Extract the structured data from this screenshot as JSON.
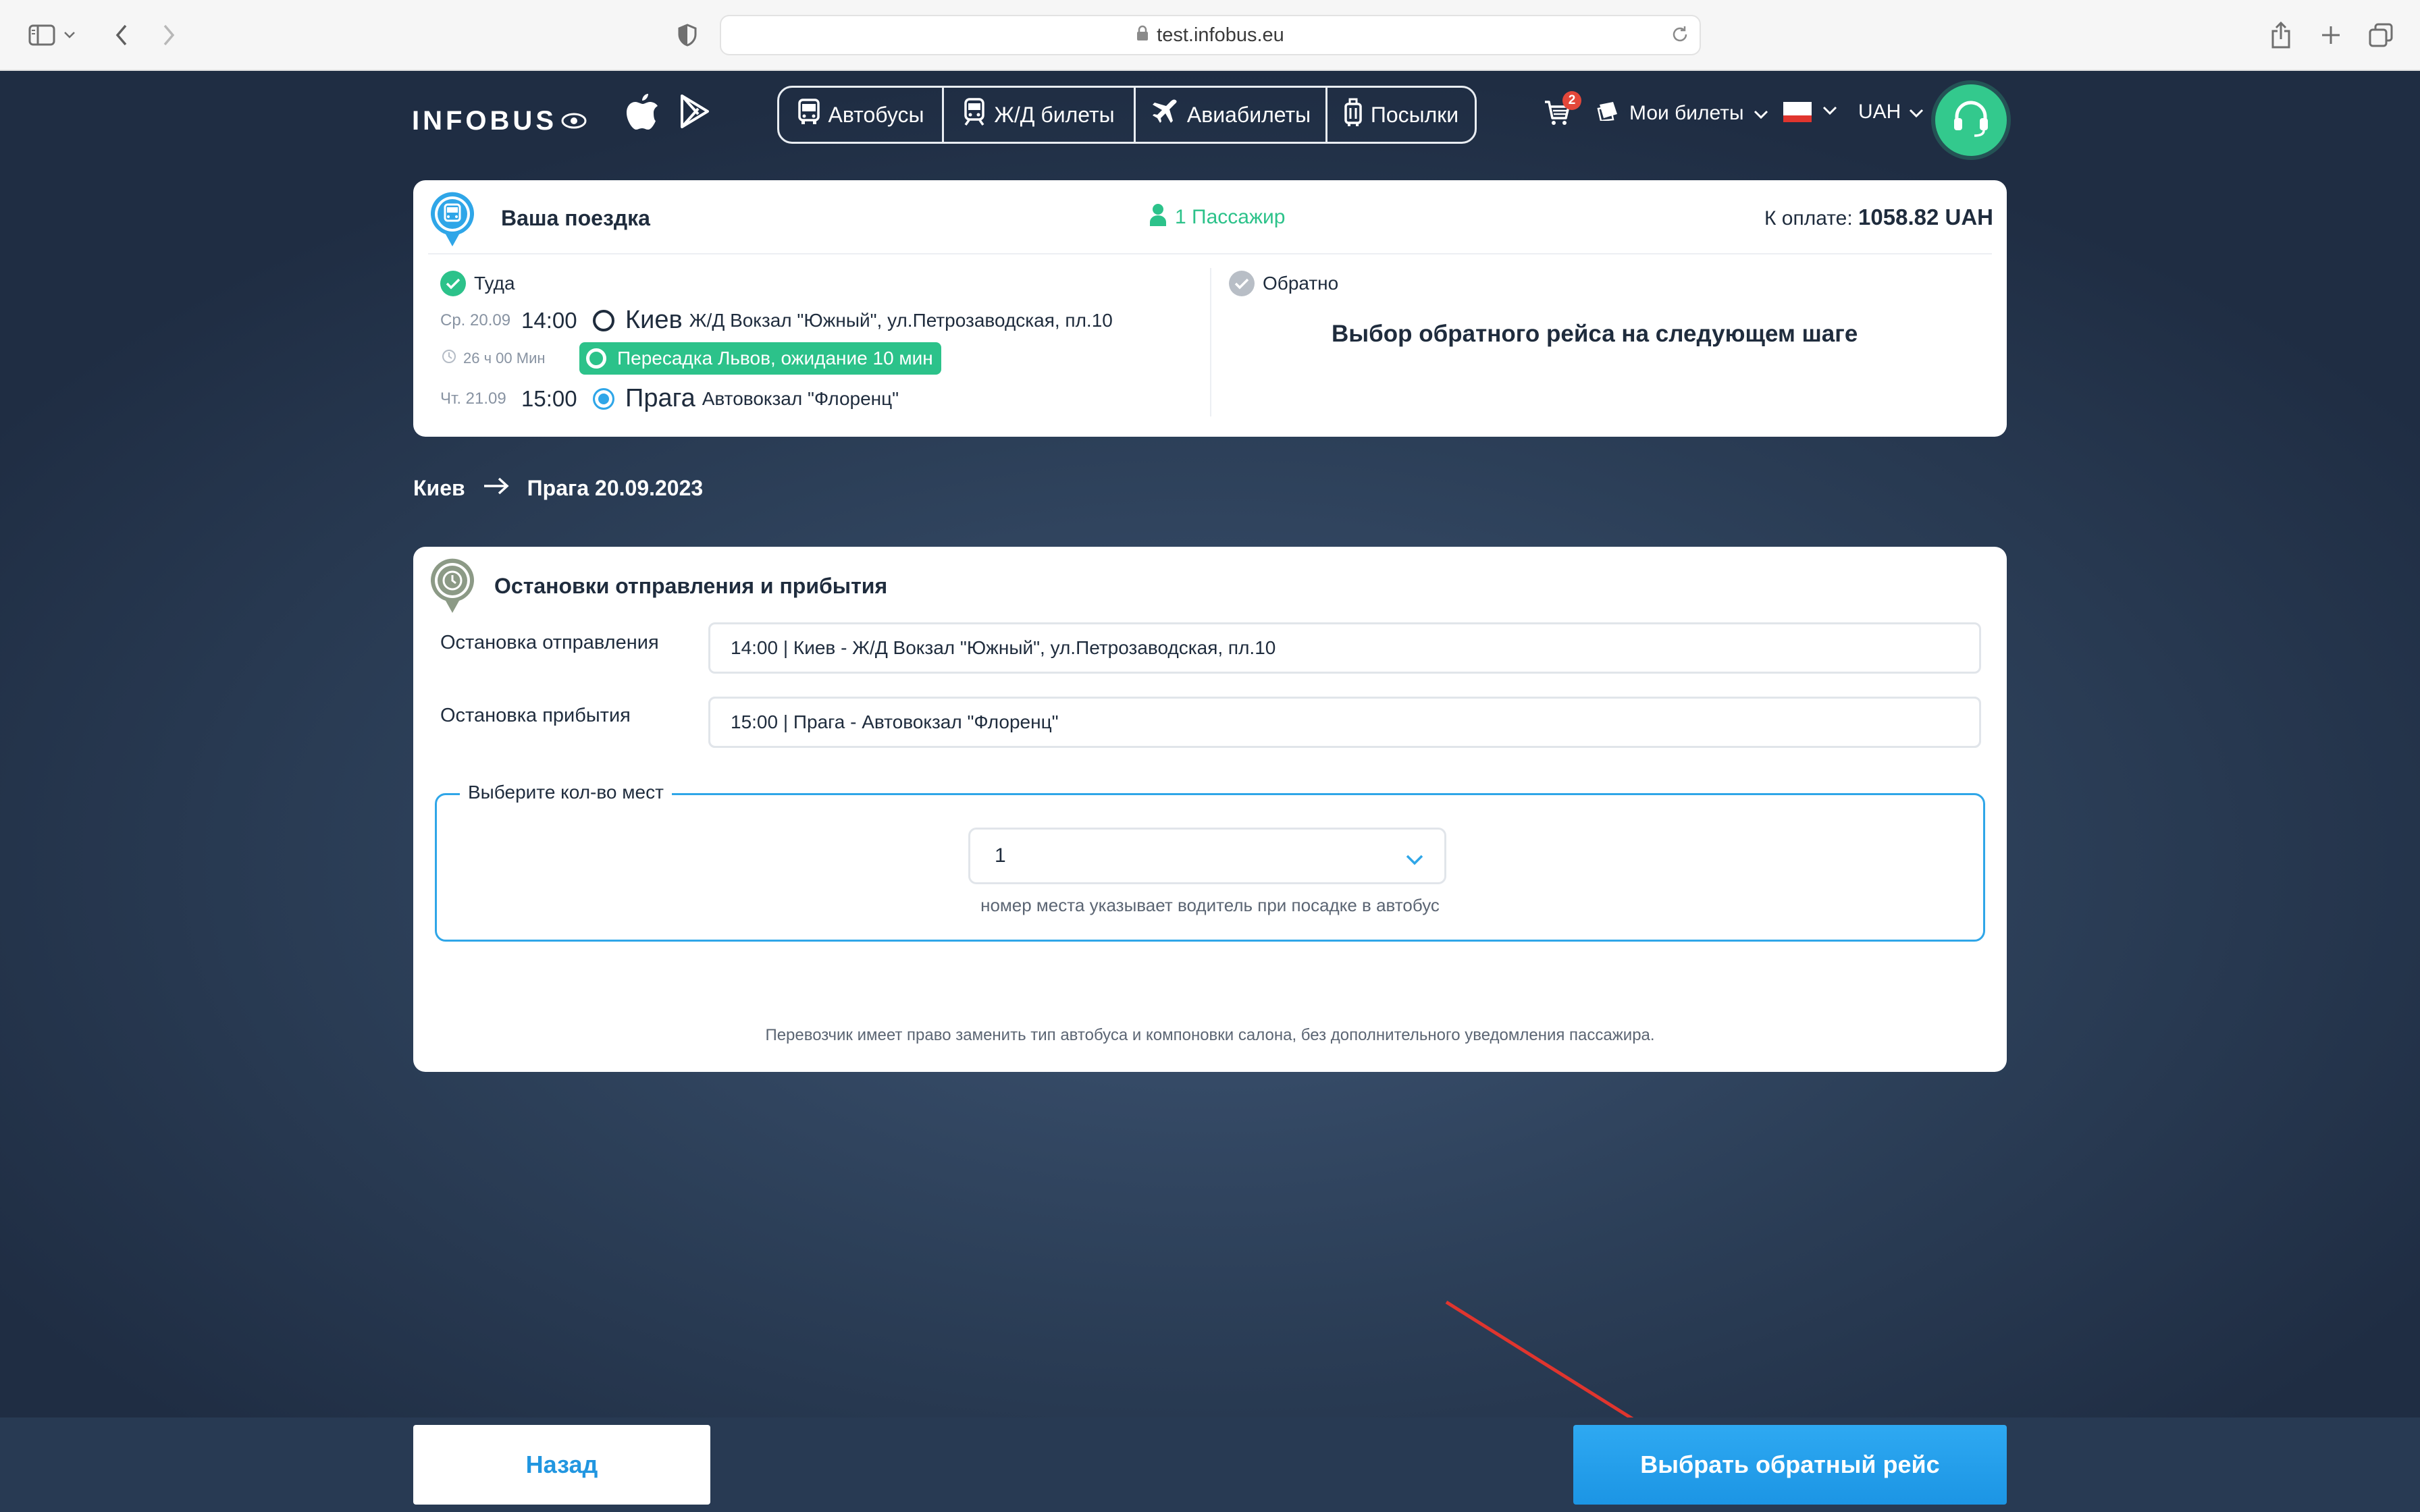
{
  "browser": {
    "url": "test.infobus.eu"
  },
  "header": {
    "logo_text": "INFOBUS",
    "nav": [
      {
        "label": "Автобусы",
        "icon": "bus-icon"
      },
      {
        "label": "Ж/Д билеты",
        "icon": "train-icon"
      },
      {
        "label": "Авиабилеты",
        "icon": "plane-icon"
      },
      {
        "label": "Посылки",
        "icon": "luggage-icon"
      }
    ],
    "cart_count": "2",
    "my_tickets": "Мои билеты",
    "currency": "UAH",
    "colors": {
      "accent_green": "#33c98d",
      "accent_blue": "#1c95e4"
    }
  },
  "trip": {
    "title": "Ваша поездка",
    "passengers": "1 Пассажир",
    "to_pay_label": "К оплате:",
    "to_pay_amount": "1058.82 UAH",
    "outbound": {
      "label": "Туда",
      "departure": {
        "date": "Ср. 20.09",
        "time": "14:00",
        "city": "Киев",
        "station": "Ж/Д Вокзал \"Южный\", ул.Петрозаводская, пл.10"
      },
      "duration": "26 ч 00 Мин",
      "transfer": "Пересадка Львов, ожидание 10 мин",
      "arrival": {
        "date": "Чт. 21.09",
        "time": "15:00",
        "city": "Прага",
        "station": "Автовокзал \"Флоренц\""
      }
    },
    "return": {
      "label": "Обратно",
      "note": "Выбор обратного рейса на следующем шаге"
    }
  },
  "route": {
    "from": "Киев",
    "to_date": "Прага 20.09.2023"
  },
  "stops": {
    "title": "Остановки отправления и прибытия",
    "departure_label": "Остановка отправления",
    "departure_value": "14:00 | Киев - Ж/Д Вокзал \"Южный\", ул.Петрозаводская, пл.10",
    "arrival_label": "Остановка прибытия",
    "arrival_value": "15:00 | Прага - Автовокзал \"Флоренц\"",
    "seats_legend": "Выберите кол-во мест",
    "seats_value": "1",
    "seats_hint": "номер места указывает водитель при посадке в автобус",
    "carrier_note": "Перевозчик имеет право заменить тип автобуса и компоновки салона, без дополнительного уведомления пассажира."
  },
  "actions": {
    "back": "Назад",
    "next": "Выбрать обратный рейс"
  }
}
